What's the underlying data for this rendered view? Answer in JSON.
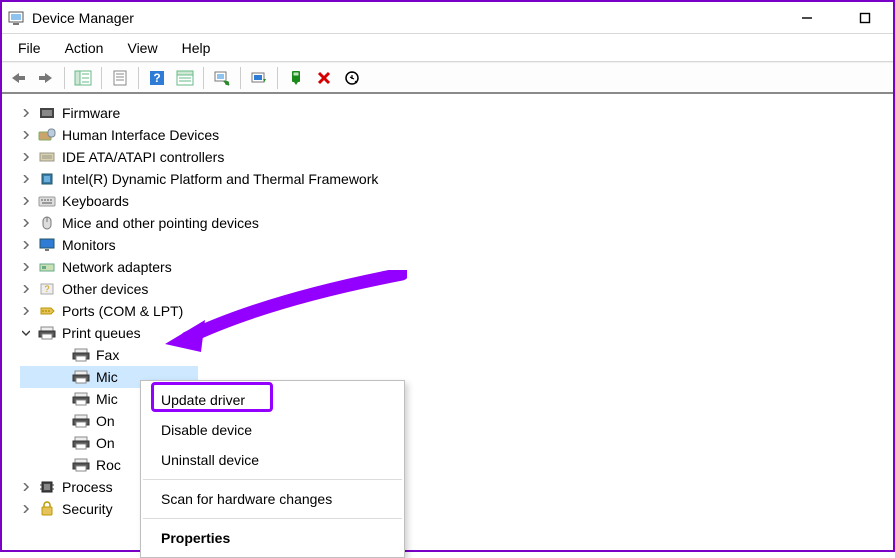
{
  "window": {
    "title": "Device Manager"
  },
  "menu": {
    "file": "File",
    "action": "Action",
    "view": "View",
    "help": "Help"
  },
  "tree": {
    "firmware": "Firmware",
    "hid": "Human Interface Devices",
    "ide": "IDE ATA/ATAPI controllers",
    "intel_dptf": "Intel(R) Dynamic Platform and Thermal Framework",
    "keyboards": "Keyboards",
    "mice": "Mice and other pointing devices",
    "monitors": "Monitors",
    "network": "Network adapters",
    "other": "Other devices",
    "ports": "Ports (COM & LPT)",
    "print_queues": "Print queues",
    "pq_fax": "Fax",
    "pq_mic1": "Mic",
    "pq_mic2": "Mic",
    "pq_on1": "On",
    "pq_on2": "On",
    "pq_roc": "Roc",
    "processors": "Process",
    "security": "Security"
  },
  "context_menu": {
    "update": "Update driver",
    "disable": "Disable device",
    "uninstall": "Uninstall device",
    "scan": "Scan for hardware changes",
    "properties": "Properties"
  },
  "annotation": {
    "highlight_color": "#9400ff"
  }
}
